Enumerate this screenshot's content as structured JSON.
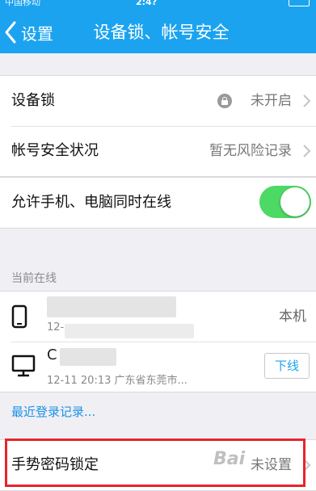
{
  "status_bar": {
    "carrier": "中国移动",
    "time": "2:4?"
  },
  "nav": {
    "back_label": "设置",
    "title": "设备锁、帐号安全"
  },
  "security": {
    "device_lock": {
      "label": "设备锁",
      "value": "未开启"
    },
    "account_status": {
      "label": "帐号安全状况",
      "value": "暂无风险记录"
    }
  },
  "online": {
    "toggle_label": "允许手机、电脑同时在线",
    "toggle_on": true,
    "section_header": "当前在线",
    "devices": [
      {
        "icon": "phone-icon",
        "sub": "12-",
        "right": "本机"
      },
      {
        "icon": "monitor-icon",
        "name": "C",
        "sub": "12-11 20:13 广东省东莞市...",
        "right": "下线"
      }
    ],
    "recent_link": "最近登录记录..."
  },
  "gesture": {
    "label": "手势密码锁定",
    "value": "未设置"
  },
  "watermark": "Bai"
}
